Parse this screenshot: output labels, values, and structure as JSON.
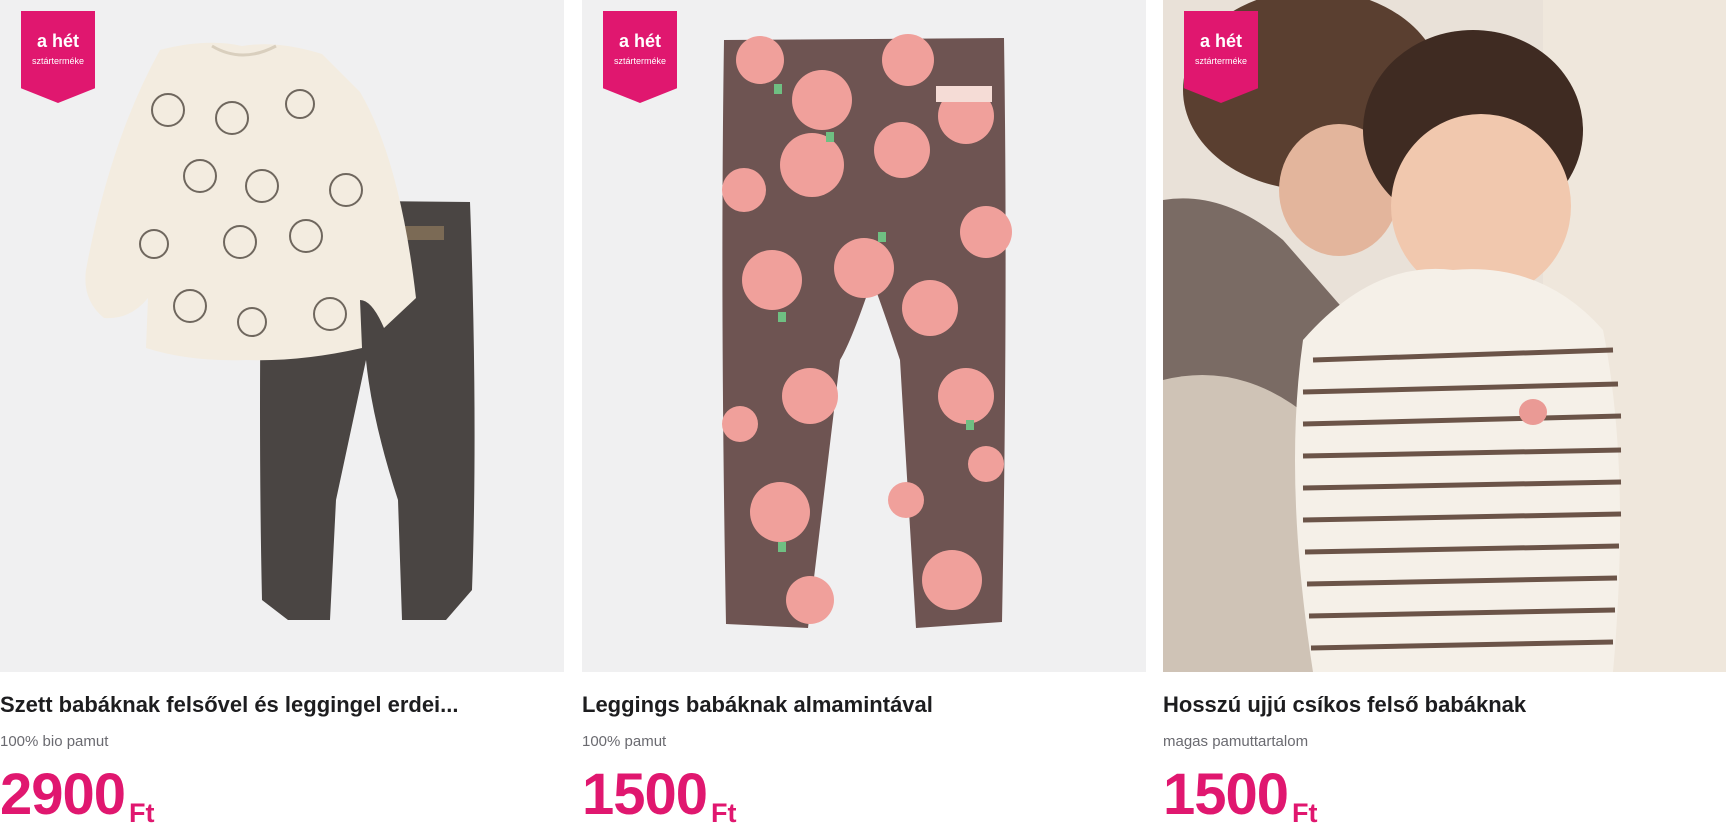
{
  "badge": {
    "title": "a hét",
    "subtitle": "sztárterméke",
    "color": "#e0176f"
  },
  "accent_color": "#e0176f",
  "products": [
    {
      "title": "Szett babáknak felsővel és leggingel erdei...",
      "material": "100% bio pamut",
      "price": "2900",
      "currency": "Ft",
      "image": "sweatshirt-and-pants-set"
    },
    {
      "title": "Leggings babáknak almamintával",
      "material": "100% pamut",
      "price": "1500",
      "currency": "Ft",
      "image": "apple-print-leggings"
    },
    {
      "title": "Hosszú ujjú csíkos felső babáknak",
      "material": "magas pamuttartalom",
      "price": "1500",
      "currency": "Ft",
      "image": "baby-in-striped-top-photo"
    }
  ]
}
